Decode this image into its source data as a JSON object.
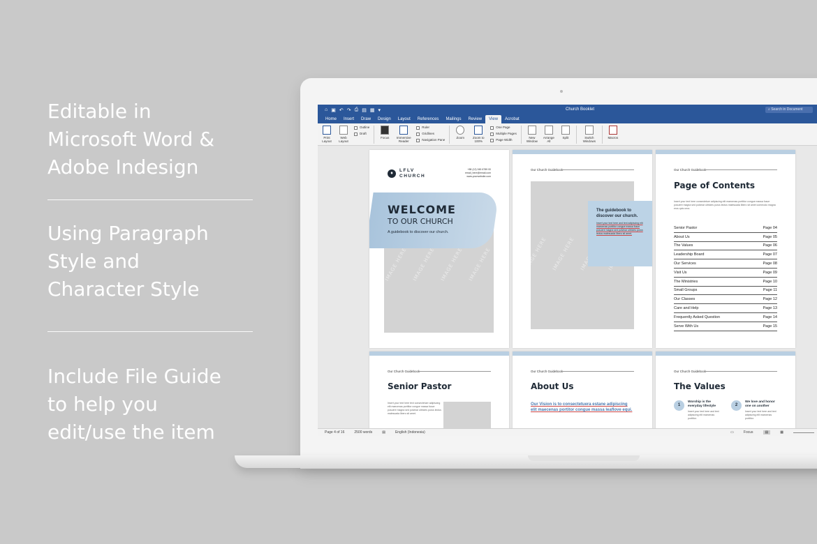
{
  "features": [
    {
      "lines": [
        "Editable in",
        "Microsoft Word &",
        "Adobe Indesign"
      ]
    },
    {
      "lines": [
        "Using Paragraph",
        "Style and",
        "Character Style"
      ]
    },
    {
      "lines": [
        "Include File Guide",
        "to help you",
        "edit/use the item"
      ]
    }
  ],
  "word": {
    "doc_title": "Church Booklet",
    "search_placeholder": "Search in Document",
    "tabs": [
      "Home",
      "Insert",
      "Draw",
      "Design",
      "Layout",
      "References",
      "Mailings",
      "Review",
      "View",
      "Acrobat"
    ],
    "active_tab": "View",
    "ribbon": {
      "print_layout": "Print Layout",
      "web_layout": "Web Layout",
      "outline": "Outline",
      "draft": "Draft",
      "focus": "Focus",
      "immersive_reader": "Immersive Reader",
      "ruler": "Ruler",
      "gridlines": "Gridlines",
      "navigation_pane": "Navigation Pane",
      "zoom": "Zoom",
      "zoom_100": "Zoom to 100%",
      "one_page": "One Page",
      "multiple_pages": "Multiple Pages",
      "page_width": "Page Width",
      "new_window": "New Window",
      "arrange_all": "Arrange All",
      "split": "Split",
      "switch_windows": "Switch Windows",
      "macros": "Macros"
    },
    "status": {
      "page": "Page 4 of 16",
      "words": "2500 words",
      "language": "English (Indonesia)",
      "focus": "Focus"
    }
  },
  "cover": {
    "logo_line1": "LFLV",
    "logo_line2": "CHURCH",
    "contact1": "+88 (12) 345 6789 00",
    "contact2": "email_here@email.com",
    "contact3": "www.yourwebsite.com",
    "welcome": "WELCOME",
    "to_our_church": "TO OUR CHURCH",
    "tagline": "A guidebook to discover our church.",
    "image_text": "IMAGE HERE"
  },
  "page2": {
    "guide_label": "Our Church Guidebook",
    "box_title": "The guidebook to discover our church.",
    "box_text": "Insert your text here and text adipiscing elit maecenas porttitor congue massa fusce posuere magna sed pulvinar ultricies purus lectus malesuada libero sit amet."
  },
  "toc": {
    "guide_label": "Our Church Guidebook",
    "title": "Page of Contents",
    "intro": "Insert your text here consectetuer adipiscing elit maecenas porttitor congue massa fusce posuere magna sed pulvinar ultricies purus lectus malesuada libero sit amet commodo magna eros quis urna.",
    "entries": [
      {
        "name": "Senior Pastor",
        "page": "Page 04"
      },
      {
        "name": "About Us",
        "page": "Page 05"
      },
      {
        "name": "The Values",
        "page": "Page 06"
      },
      {
        "name": "Leadership Board",
        "page": "Page 07"
      },
      {
        "name": "Our Services",
        "page": "Page 08"
      },
      {
        "name": "Visit Us",
        "page": "Page 09"
      },
      {
        "name": "The Ministries",
        "page": "Page 10"
      },
      {
        "name": "Small Groups",
        "page": "Page 11"
      },
      {
        "name": "Our Classes",
        "page": "Page 12"
      },
      {
        "name": "Care and Help",
        "page": "Page 13"
      },
      {
        "name": "Frequently Asked Question",
        "page": "Page 14"
      },
      {
        "name": "Serve With Us",
        "page": "Page 15"
      }
    ]
  },
  "pastor": {
    "guide_label": "Our Church Guidebook",
    "title": "Senior Pastor",
    "text": "Insert your text here text consectetuer adipiscing elit maecenas porttitor congue massa fusce posuere magna sed pulvinar ultricies purus lectus malesuada libero sit amet."
  },
  "about": {
    "guide_label": "Our Church Guidebook",
    "title": "About Us",
    "vision": "Our Vision is to consectetuera estane adipiscing elit maecenas portitor congue massa leaflove equi."
  },
  "values": {
    "guide_label": "Our Church Guidebook",
    "title": "The Values",
    "v1_num": "1",
    "v1_title": "Worship is the everyday lifestyle",
    "v2_num": "2",
    "v2_title": "We love and honor one on another",
    "v_text": "Insert your text here and text adipiscing elit maecenas porttitor."
  },
  "colors": {
    "word_blue": "#2b579a",
    "accent_blue": "#b9cfe2",
    "light_blue": "#cfe0ee",
    "dark_text": "#1f2a36"
  }
}
